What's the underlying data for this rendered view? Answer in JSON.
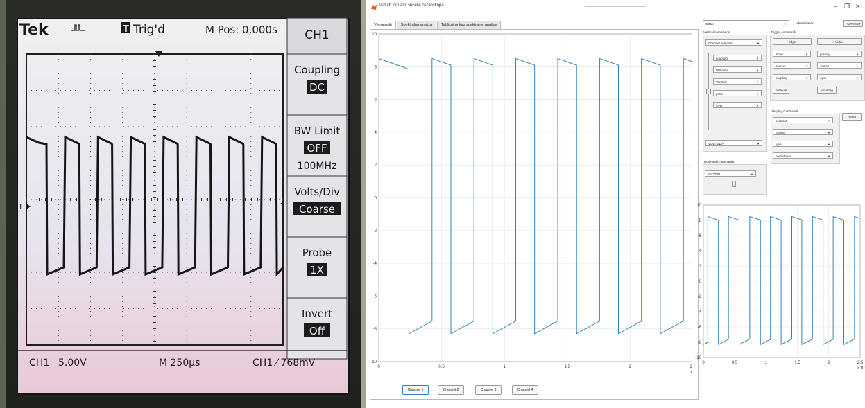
{
  "photo": {
    "brand": "Tek",
    "trigger_state": "Trig'd",
    "trigger_badge": "T",
    "m_pos": "M Pos: 0.000s",
    "ch1_marker": "1",
    "status_ch": "CH1",
    "status_volts": "5.00V",
    "status_time": "M 250µs",
    "status_trigger": "CH1 ⁄ 768mV",
    "menu": {
      "title": "CH1",
      "items": [
        {
          "label": "Coupling",
          "value": "DC",
          "extra": ""
        },
        {
          "label": "BW Limit",
          "value": "OFF",
          "extra": "100MHz"
        },
        {
          "label": "Volts/Div",
          "value": "Coarse",
          "extra": ""
        },
        {
          "label": "Probe",
          "value": "1X",
          "extra": ""
        },
        {
          "label": "Invert",
          "value": "Off",
          "extra": ""
        }
      ]
    }
  },
  "app": {
    "title": "Matlab virtualni sucelje osciloskopa",
    "window_controls": {
      "minimize": "–",
      "maximize": "❐",
      "close": "✕"
    },
    "tabs": [
      "Vremenski",
      "Spektralna analiza",
      "Tablicni prikaz spektralne analize"
    ],
    "com_port": "COM4",
    "identification_button": "Identification",
    "autoset_button": "AUTOSET",
    "vertical": {
      "title": "Vertical commands",
      "channel_selection": "Channel selection",
      "dropdowns": [
        "coupling",
        "BW Limit",
        "Variable",
        "probe",
        "invert"
      ],
      "volts_div": "VOLTS/DIV"
    },
    "horizontal": {
      "title": "Horizontal commands",
      "sec_div": "SEC/DIV",
      "slider_value": 0.55
    },
    "trigger": {
      "title": "Trigger commands",
      "edge_button": "Edge",
      "video_button": "Video",
      "left_dropdowns": [
        "slope",
        "source",
        "coupling"
      ],
      "right_dropdowns": [
        "polarity",
        "source",
        "sync"
      ],
      "set_level_button": "set level",
      "force_trig_button": "force trig"
    },
    "display": {
      "title": "Display commands",
      "reset_button": "Reset",
      "dropdowns": [
        "contrast",
        "format",
        "type",
        "persistence"
      ]
    },
    "channels": [
      "Channel 1",
      "Channel 2",
      "Channel 3",
      "Channel 4"
    ],
    "active_channel": "Channel 1",
    "colors": {
      "trace": "#1f77b4",
      "active_border": "#2d7fd0"
    }
  },
  "chart_data": [
    {
      "type": "line",
      "title": "",
      "xlabel": "",
      "ylabel": "",
      "x_exponent_label": "×10⁻³",
      "xlim": [
        0,
        2.5
      ],
      "ylim": [
        -10,
        10
      ],
      "xticks": [
        "0",
        "0.5",
        "1",
        "1.5",
        "2",
        "2.5"
      ],
      "yticks": [
        "10",
        "8",
        "6",
        "4",
        "2",
        "0",
        "-2",
        "-4",
        "-6",
        "-8",
        "-10"
      ],
      "grid": true,
      "series": [
        {
          "color": "#1f77b4",
          "high_level": 8.5,
          "low_level": -8.3,
          "period_ms": 0.333,
          "rising_edges_ms": [
            0.424,
            0.757,
            1.09,
            1.424,
            1.757,
            2.09,
            2.424
          ],
          "falling_edges_ms": [
            0.24,
            0.574,
            0.907,
            1.24,
            1.574,
            1.907,
            2.24
          ]
        }
      ]
    },
    {
      "type": "line",
      "title": "",
      "xlim": [
        0,
        2.5
      ],
      "ylim": [
        -10,
        10
      ],
      "x_exponent_label": "×10⁻³",
      "xticks": [
        "0",
        "0.5",
        "1",
        "1.5",
        "2",
        "2.5"
      ],
      "yticks": [
        "10",
        "8",
        "6",
        "4",
        "2",
        "0",
        "-2",
        "-4",
        "-6",
        "-8",
        "-10"
      ],
      "grid": true,
      "series": [
        {
          "color": "#1f77b4",
          "high_level": 8.5,
          "low_level": -8.3,
          "period_ms": 0.333,
          "rising_edges_ms": [
            0.07,
            0.4,
            0.74,
            1.07,
            1.41,
            1.74,
            2.07,
            2.41
          ],
          "falling_edges_ms": [
            0.24,
            0.57,
            0.91,
            1.24,
            1.57,
            1.91,
            2.24
          ]
        }
      ]
    }
  ]
}
